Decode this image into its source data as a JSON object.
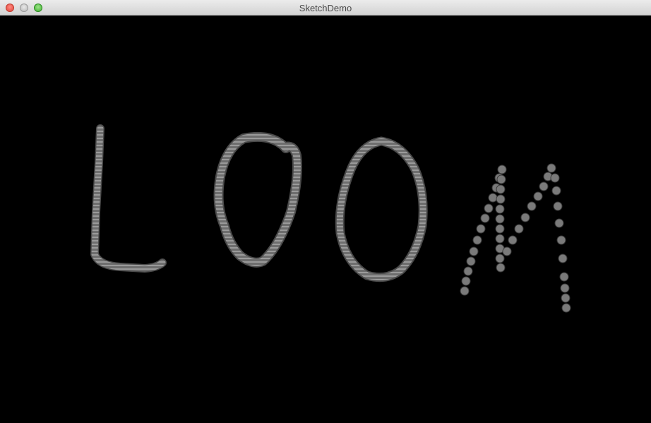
{
  "window": {
    "title": "SketchDemo"
  },
  "controls": {
    "close": "close-button",
    "minimize": "minimize-button",
    "zoom": "zoom-button"
  },
  "canvas": {
    "background": "#000000",
    "stroke_color": "#8a8a8a",
    "strokes": [
      "L",
      "O",
      "O",
      "M"
    ]
  }
}
